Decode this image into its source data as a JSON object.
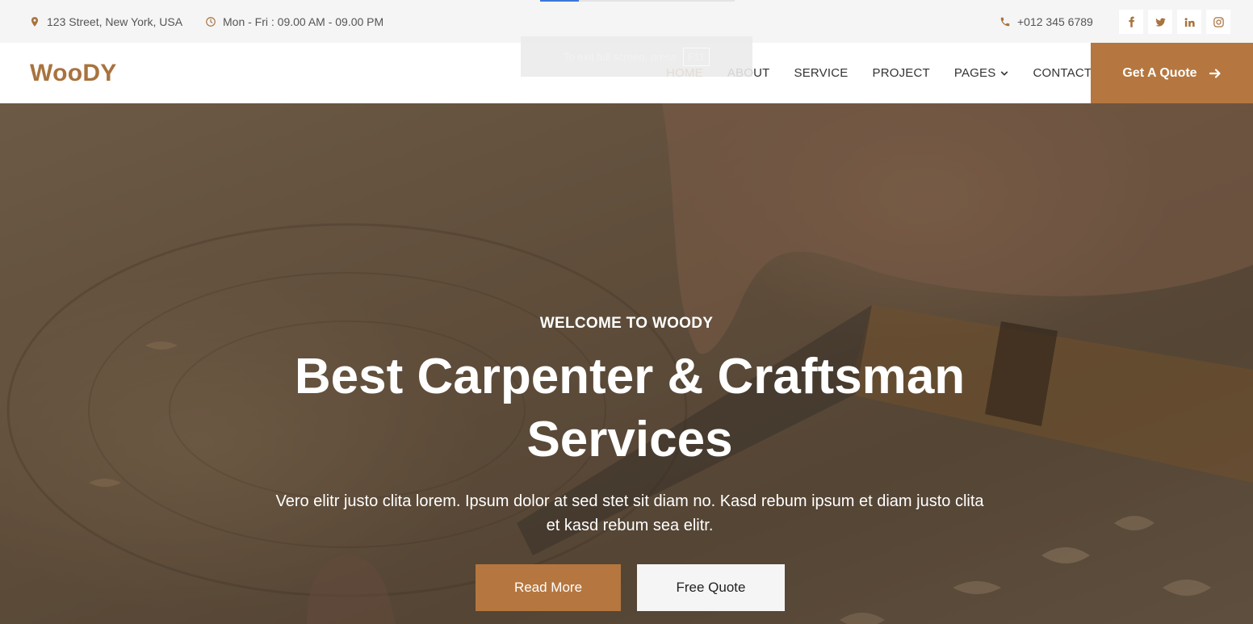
{
  "topbar": {
    "address": "123 Street, New York, USA",
    "hours": "Mon - Fri : 09.00 AM - 09.00 PM",
    "phone": "+012 345 6789",
    "socials": [
      "facebook-icon",
      "twitter-icon",
      "linkedin-icon",
      "instagram-icon"
    ]
  },
  "fullscreen_toast": {
    "text": "To exit full screen, press",
    "key": "F11"
  },
  "navbar": {
    "brand": "WooDY",
    "links": [
      "HOME",
      "ABOUT",
      "SERVICE",
      "PROJECT",
      "PAGES",
      "CONTACT"
    ],
    "active": "HOME",
    "quote_button": "Get A Quote"
  },
  "hero": {
    "welcome": "WELCOME TO WOODY",
    "headline": "Best Carpenter & Craftsman Services",
    "lead": "Vero elitr justo clita lorem. Ipsum dolor at sed stet sit diam no. Kasd rebum ipsum et diam justo clita et kasd rebum sea elitr.",
    "read_more": "Read More",
    "free_quote": "Free Quote"
  },
  "colors": {
    "accent": "#b5773f",
    "brand_text": "#a8733f",
    "topbar_bg": "#f5f5f5"
  }
}
